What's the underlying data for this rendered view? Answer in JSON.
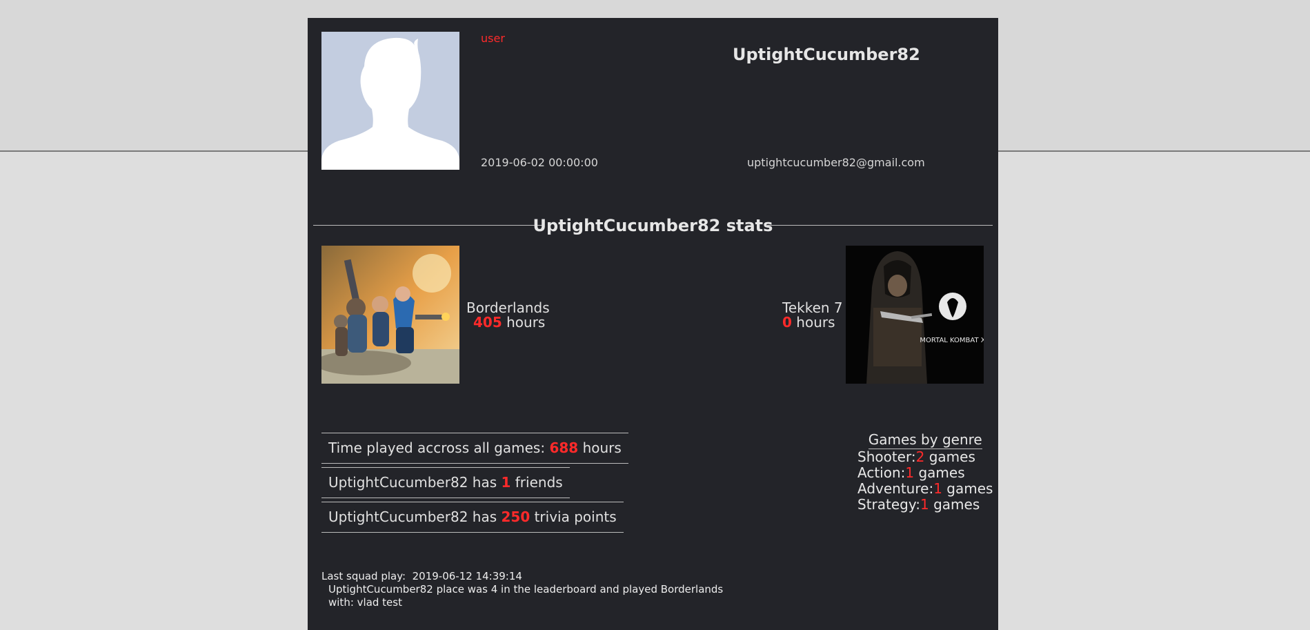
{
  "profile": {
    "role": "user",
    "username": "UptightCucumber82",
    "joined": "2019-06-02 00:00:00",
    "email": "uptightcucumber82@gmail.com"
  },
  "stats": {
    "heading": "UptightCucumber82 stats",
    "games": [
      {
        "name": "Borderlands",
        "hours": "405",
        "hours_label": "hours",
        "image": "borderlands-cover"
      },
      {
        "name": "Tekken 7",
        "hours": "0",
        "hours_label": "hours",
        "image": "mortal-kombat-x-cover",
        "image_text": "MORTAL KOMBAT X"
      }
    ],
    "time_played": {
      "prefix": "Time played accross all games:",
      "value": "688",
      "suffix": "hours"
    },
    "friends": {
      "prefix": "UptightCucumber82 has",
      "value": "1",
      "suffix": "friends"
    },
    "trivia": {
      "prefix": "UptightCucumber82 has",
      "value": "250",
      "suffix": "trivia points"
    }
  },
  "genres": {
    "title": "Games by genre",
    "games_label": "games",
    "items": [
      {
        "name": "Shooter:",
        "count": "2"
      },
      {
        "name": "Action:",
        "count": "1"
      },
      {
        "name": "Adventure:",
        "count": "1"
      },
      {
        "name": "Strategy:",
        "count": "1"
      }
    ]
  },
  "squad": {
    "label": "Last squad play:",
    "datetime": "2019-06-12 14:39:14",
    "line2": "UptightCucumber82 place was 4 in the leaderboard and played Borderlands",
    "line3": "with: vlad test"
  },
  "colors": {
    "card_bg": "#232429",
    "accent_red": "#ff2a2a",
    "page_bg": "#dedede"
  }
}
